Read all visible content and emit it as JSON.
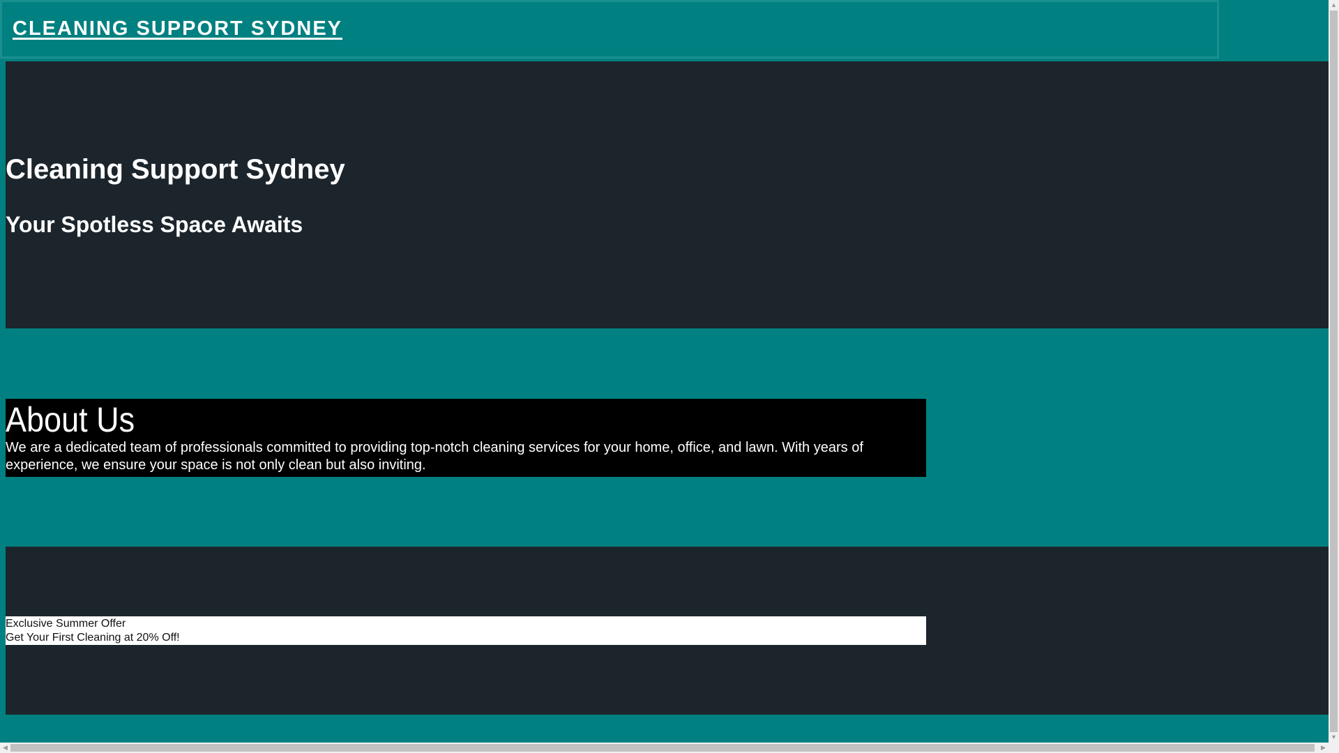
{
  "header": {
    "logo": "CLEANING SUPPORT SYDNEY"
  },
  "hero": {
    "title": "Cleaning Support Sydney",
    "subtitle": "Your Spotless Space Awaits"
  },
  "about": {
    "heading": "About Us",
    "text": "We are a dedicated team of professionals committed to providing top-notch cleaning services for your home, office, and lawn. With years of experience, we ensure your space is not only clean but also inviting."
  },
  "offer": {
    "title": "Exclusive Summer Offer",
    "text": "Get Your First Cleaning at 20% Off!"
  },
  "colors": {
    "teal": "#008080",
    "dark": "#1c252c",
    "black": "#000000"
  }
}
